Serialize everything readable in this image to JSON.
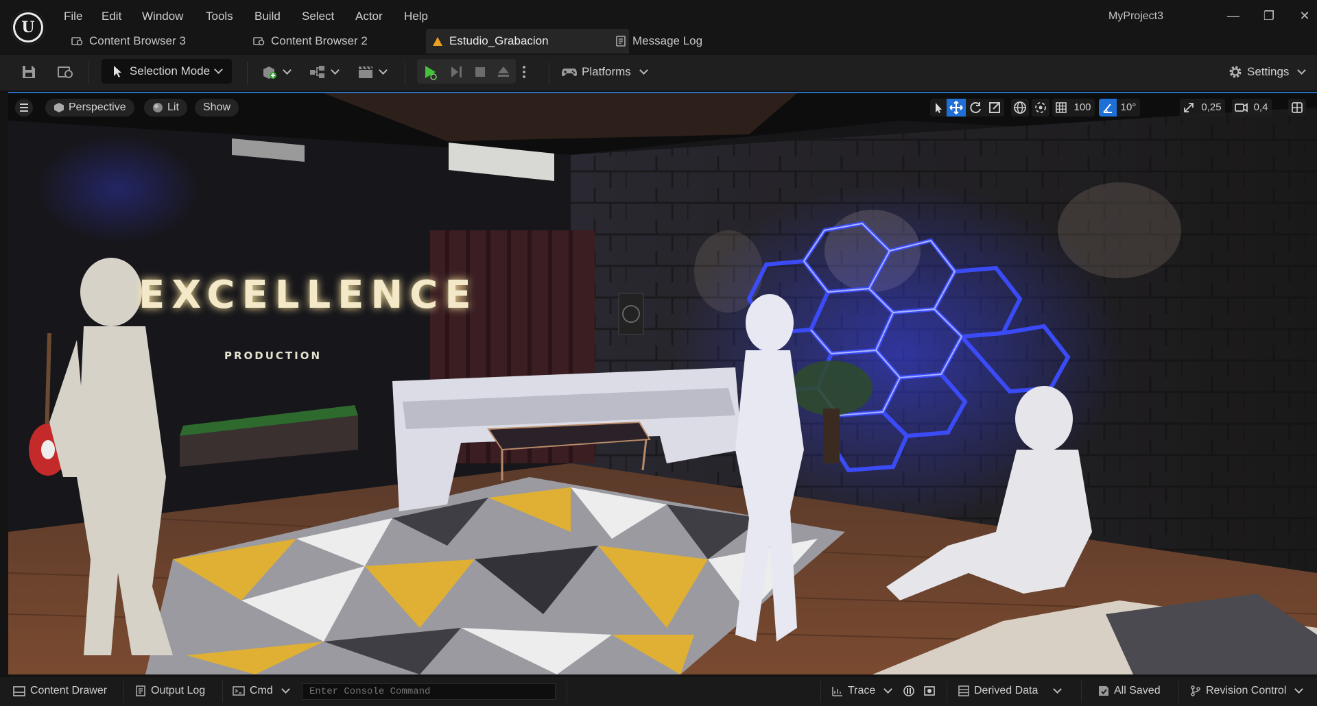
{
  "app": {
    "project_name": "MyProject3"
  },
  "menu": [
    "File",
    "Edit",
    "Window",
    "Tools",
    "Build",
    "Select",
    "Actor",
    "Help"
  ],
  "tabs": [
    {
      "label": "Content Browser 3",
      "icon": "content-browser-icon"
    },
    {
      "label": "Content Browser 2",
      "icon": "content-browser-icon"
    },
    {
      "label": "Estudio_Grabacion",
      "icon": "level-icon",
      "active": true
    },
    {
      "label": "Message Log",
      "icon": "message-log-icon"
    }
  ],
  "toolbar": {
    "selection_mode": "Selection Mode",
    "platforms": "Platforms",
    "settings": "Settings"
  },
  "viewport": {
    "view_mode": "Perspective",
    "lighting": "Lit",
    "show": "Show",
    "grid_snap": "100",
    "rotation_snap": "10°",
    "scale_snap": "0,25",
    "camera_speed": "0,4",
    "scene": {
      "sign_text": "EXCELLENCE",
      "sign_subtext": "PRODUCTION"
    }
  },
  "bottombar": {
    "content_drawer": "Content Drawer",
    "output_log": "Output Log",
    "cmd": "Cmd",
    "console_placeholder": "Enter Console Command",
    "trace": "Trace",
    "derived_data": "Derived Data",
    "all_saved": "All Saved",
    "revision_control": "Revision Control"
  },
  "colors": {
    "accent": "#2a6fbf",
    "play_green": "#44c23a",
    "neon_blue": "#3c4dff"
  }
}
